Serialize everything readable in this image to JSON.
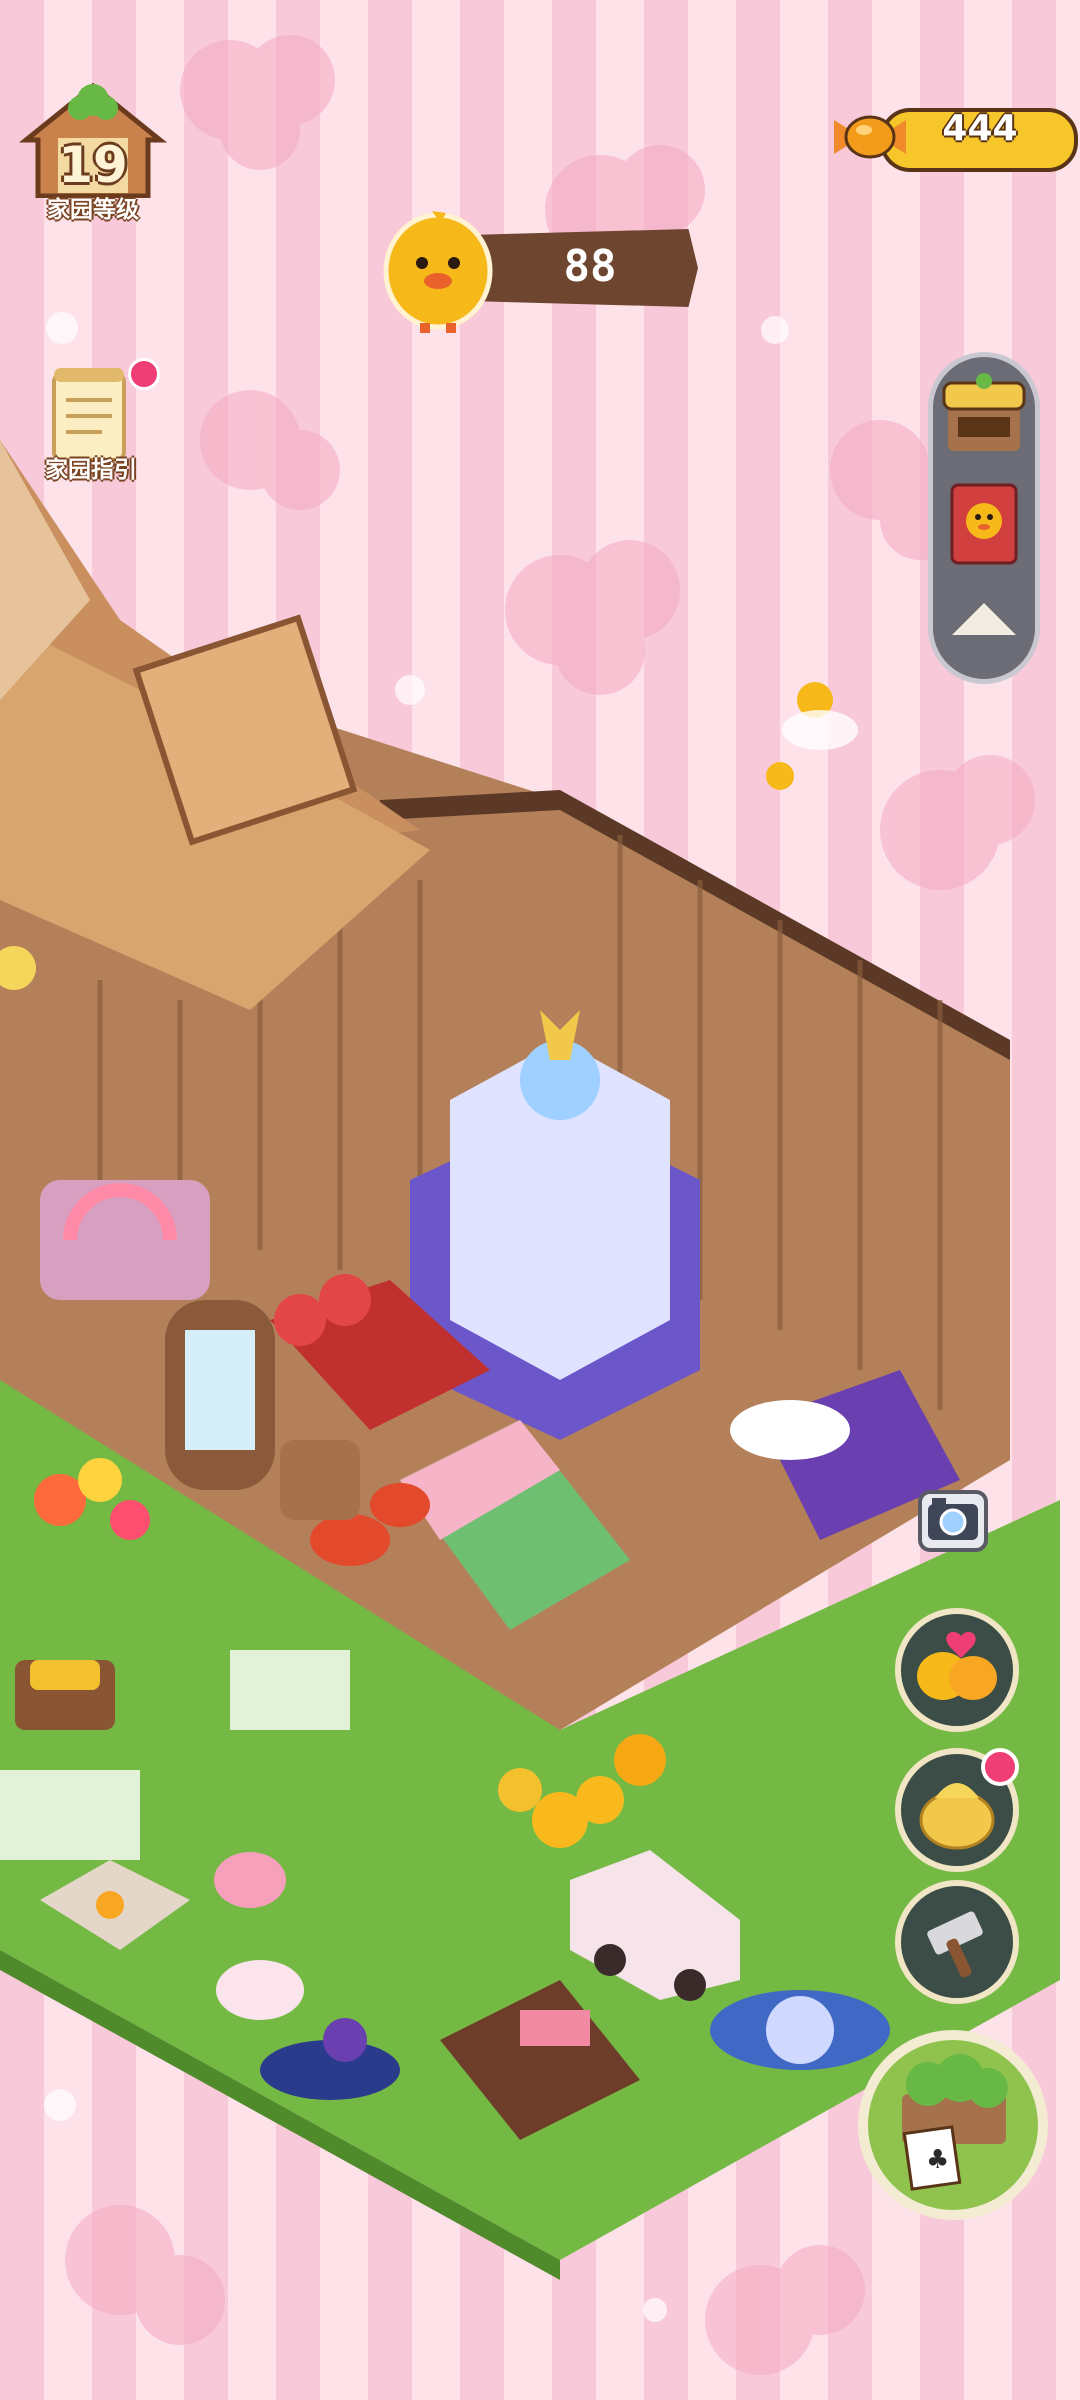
{
  "hud": {
    "home_level": {
      "value": "19",
      "label": "家园等级",
      "icon": "house-icon"
    },
    "guide": {
      "label": "家园指引",
      "icon": "scroll-icon",
      "has_notification": true
    },
    "duck_count": {
      "value": "88",
      "icon": "duck-icon"
    },
    "candy_count": {
      "value": "444",
      "icon": "candy-icon"
    }
  },
  "side_menu": [
    {
      "name": "shop",
      "icon": "market-stall-icon"
    },
    {
      "name": "duck-book",
      "icon": "book-icon"
    },
    {
      "name": "collapse",
      "icon": "triangle-up-icon"
    }
  ],
  "action_buttons": [
    {
      "name": "photo",
      "icon": "camera-icon"
    },
    {
      "name": "ducks",
      "icon": "ducks-hug-icon"
    },
    {
      "name": "treasure",
      "icon": "golden-bag-icon",
      "has_notification": true
    },
    {
      "name": "build",
      "icon": "hammer-icon"
    },
    {
      "name": "decorate",
      "icon": "planter-easel-icon"
    }
  ],
  "colors": {
    "background_pink": "#f8c9d8",
    "wood": "#b4805a",
    "grass": "#74b944",
    "gold": "#f6c62a",
    "notification": "#ef3d75"
  }
}
